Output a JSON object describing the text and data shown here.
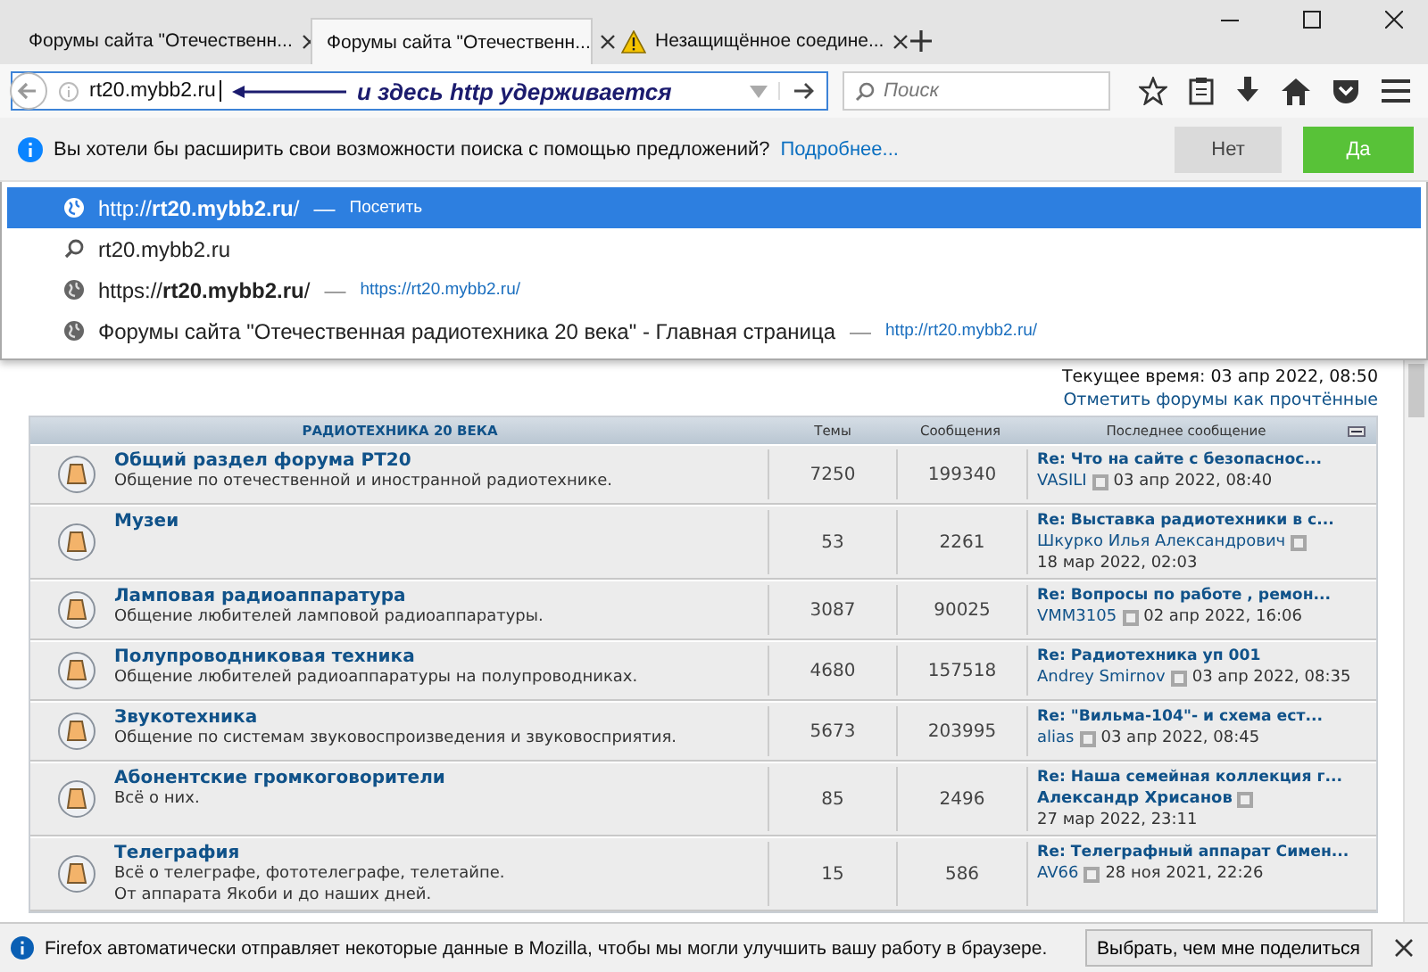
{
  "tabs": [
    {
      "title": "Форумы сайта \"Отечественн...",
      "selected": false,
      "kind": "page"
    },
    {
      "title": "Форумы сайта \"Отечественн...",
      "selected": true,
      "kind": "page"
    },
    {
      "title": "Незащищённое соедине...",
      "selected": false,
      "kind": "insecure"
    }
  ],
  "address": {
    "value": "rt20.mybb2.ru",
    "annotation": "и здесь http удерживается"
  },
  "search": {
    "placeholder": "Поиск"
  },
  "notification": {
    "text": "Вы хотели бы расширить свои возможности поиска с помощью предложений?",
    "link": "Подробнее...",
    "buttons": [
      {
        "label": "Нет",
        "kind": "secondary"
      },
      {
        "label": "Да",
        "kind": "primary"
      }
    ]
  },
  "suggestions": [
    {
      "kind": "visit",
      "text": "http://**rt20.mybb2.ru**/",
      "separator": "—",
      "secondary": "Посетить",
      "selected": true
    },
    {
      "kind": "search",
      "text": "rt20.mybb2.ru",
      "selected": false
    },
    {
      "kind": "history",
      "text": "https://**rt20.mybb2.ru**/",
      "separator": "—",
      "secondary": "https://rt20.mybb2.ru/",
      "selected": false
    },
    {
      "kind": "history",
      "text": "Форумы сайта \"Отечественная радиотехника 20 века\" - Главная страница",
      "separator": "—",
      "secondary": "http://rt20.mybb2.ru/",
      "selected": false
    }
  ],
  "forum": {
    "current_time": "Текущее время: 03 апр 2022, 08:50",
    "mark_read": "Отметить форумы как прочтённые",
    "columns": [
      "РАДИОТЕХНИКА 20 ВЕКА",
      "Темы",
      "Сообщения",
      "Последнее сообщение"
    ],
    "rows": [
      {
        "name": "Общий раздел форума РТ20",
        "description": [
          "Общение по отечественной и иностранной радиотехнике."
        ],
        "topics": "7250",
        "posts": "199340",
        "last_title": "Re: Что на сайте с безопаснос...",
        "author": "VASILI",
        "author_bold": false,
        "date": "03 апр 2022, 08:40"
      },
      {
        "name": "Музеи",
        "description": [],
        "topics": "53",
        "posts": "2261",
        "last_title": "Re: Выставка радиотехники в с...",
        "author": "Шкурко Илья Александрович",
        "author_bold": false,
        "date": "18 мар 2022, 02:03"
      },
      {
        "name": "Ламповая радиоаппаратура",
        "description": [
          "Общение любителей ламповой радиоаппаратуры."
        ],
        "topics": "3087",
        "posts": "90025",
        "last_title": "Re: Вопросы по работе , ремон...",
        "author": "VMM3105",
        "author_bold": false,
        "date": "02 апр 2022, 16:06"
      },
      {
        "name": "Полупроводниковая техника",
        "description": [
          "Общение любителей радиоаппаратуры на полупроводниках."
        ],
        "topics": "4680",
        "posts": "157518",
        "last_title": "Re: Радиотехника уп 001",
        "author": "Andrey Smirnov",
        "author_bold": false,
        "date": "03 апр 2022, 08:35"
      },
      {
        "name": "Звукотехника",
        "description": [
          "Общение по системам звуковоспроизведения и звуковосприятия."
        ],
        "topics": "5673",
        "posts": "203995",
        "last_title": "Re: \"Вильма-104\"- и схема ест...",
        "author": "alias",
        "author_bold": false,
        "date": "03 апр 2022, 08:45"
      },
      {
        "name": "Абонентские громкоговорители",
        "description": [
          "Всё о них."
        ],
        "topics": "85",
        "posts": "2496",
        "last_title": "Re: Наша семейная коллекция г...",
        "author": "Александр Хрисанов",
        "author_bold": true,
        "date": "27 мар 2022, 23:11"
      },
      {
        "name": "Телеграфия",
        "description": [
          "Всё о телеграфе, фототелеграфе, телетайпе.",
          "От аппарата Якоби и до наших дней."
        ],
        "topics": "15",
        "posts": "586",
        "last_title": "Re: Телеграфный аппарат Симен...",
        "author": "AV66",
        "author_bold": false,
        "date": "28 ноя 2021, 22:26"
      }
    ]
  },
  "status_bar": {
    "text": "Firefox автоматически отправляет некоторые данные в Mozilla, чтобы мы могли улучшить вашу работу в браузере.",
    "button": "Выбрать, чем мне поделиться"
  }
}
